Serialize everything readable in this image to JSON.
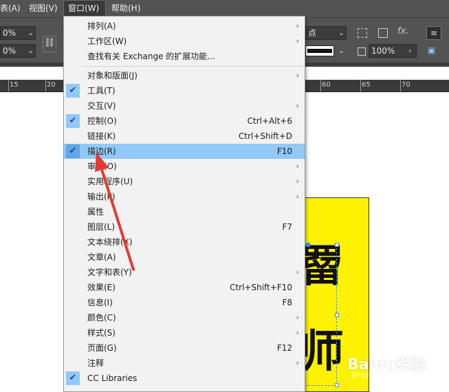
{
  "menubar": {
    "items": [
      {
        "label": "表(A)"
      },
      {
        "label": "视图(V)"
      },
      {
        "label": "窗口(W)"
      },
      {
        "label": "帮助(H)"
      }
    ]
  },
  "control_panel": {
    "zoom_top": "0%",
    "zoom_bottom": "0%",
    "stroke_unit": "点",
    "opacity": "100%",
    "fx_label": "fx."
  },
  "ruler": {
    "ticks": [
      "15",
      "20",
      "60",
      "65",
      "70"
    ]
  },
  "canvas": {
    "chars": [
      "罶",
      "师"
    ]
  },
  "window_menu": {
    "items": [
      {
        "label": "排列(A)",
        "shortcut": "",
        "submenu": true,
        "checked": false,
        "highlighted": false
      },
      {
        "label": "工作区(W)",
        "shortcut": "",
        "submenu": true,
        "checked": false,
        "highlighted": false
      },
      {
        "label": "查找有关 Exchange 的扩展功能...",
        "shortcut": "",
        "submenu": false,
        "checked": false,
        "highlighted": false
      },
      {
        "label": "对象和版面(J)",
        "shortcut": "",
        "submenu": true,
        "checked": false,
        "highlighted": false
      },
      {
        "label": "工具(T)",
        "shortcut": "",
        "submenu": false,
        "checked": true,
        "highlighted": false
      },
      {
        "label": "交互(V)",
        "shortcut": "",
        "submenu": true,
        "checked": false,
        "highlighted": false
      },
      {
        "label": "控制(O)",
        "shortcut": "Ctrl+Alt+6",
        "submenu": false,
        "checked": true,
        "highlighted": false
      },
      {
        "label": "链接(K)",
        "shortcut": "Ctrl+Shift+D",
        "submenu": false,
        "checked": false,
        "highlighted": false
      },
      {
        "label": "描边(R)",
        "shortcut": "F10",
        "submenu": false,
        "checked": true,
        "highlighted": true
      },
      {
        "label": "审稿(O)",
        "shortcut": "",
        "submenu": true,
        "checked": false,
        "highlighted": false
      },
      {
        "label": "实用程序(U)",
        "shortcut": "",
        "submenu": true,
        "checked": false,
        "highlighted": false
      },
      {
        "label": "输出(P)",
        "shortcut": "",
        "submenu": true,
        "checked": false,
        "highlighted": false
      },
      {
        "label": "属性",
        "shortcut": "",
        "submenu": false,
        "checked": false,
        "highlighted": false
      },
      {
        "label": "图层(L)",
        "shortcut": "F7",
        "submenu": false,
        "checked": false,
        "highlighted": false
      },
      {
        "label": "文本绕排(X)",
        "shortcut": "",
        "submenu": false,
        "checked": false,
        "highlighted": false
      },
      {
        "label": "文章(A)",
        "shortcut": "",
        "submenu": false,
        "checked": false,
        "highlighted": false
      },
      {
        "label": "文字和表(Y)",
        "shortcut": "",
        "submenu": true,
        "checked": false,
        "highlighted": false
      },
      {
        "label": "效果(E)",
        "shortcut": "Ctrl+Shift+F10",
        "submenu": false,
        "checked": false,
        "highlighted": false
      },
      {
        "label": "信息(I)",
        "shortcut": "F8",
        "submenu": false,
        "checked": false,
        "highlighted": false
      },
      {
        "label": "颜色(C)",
        "shortcut": "",
        "submenu": true,
        "checked": false,
        "highlighted": false
      },
      {
        "label": "样式(S)",
        "shortcut": "",
        "submenu": true,
        "checked": false,
        "highlighted": false
      },
      {
        "label": "页面(G)",
        "shortcut": "F12",
        "submenu": false,
        "checked": false,
        "highlighted": false
      },
      {
        "label": "注释",
        "shortcut": "",
        "submenu": true,
        "checked": false,
        "highlighted": false
      },
      {
        "label": "CC Libraries",
        "shortcut": "",
        "submenu": false,
        "checked": true,
        "highlighted": false
      }
    ],
    "colors": {
      "highlight": "#91c9f7",
      "check_bg": "#91c9f7",
      "arrow": "#e53935"
    }
  },
  "watermark": {
    "logo": "Baidu经验",
    "url": "jingyan.baidu.com"
  }
}
